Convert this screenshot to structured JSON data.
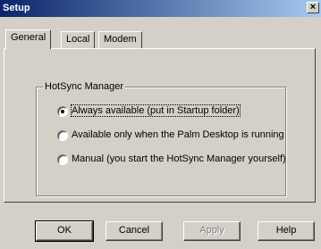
{
  "window": {
    "title": "Setup",
    "close_glyph": "×"
  },
  "tabs": [
    {
      "label": "General",
      "selected": true
    },
    {
      "label": "Local",
      "selected": false
    },
    {
      "label": "Modem",
      "selected": false
    }
  ],
  "group": {
    "label": "HotSync Manager",
    "options": [
      {
        "label": "Always available (put in Startup folder)",
        "checked": true
      },
      {
        "label": "Available only when the Palm Desktop is running",
        "checked": false
      },
      {
        "label": "Manual (you start the HotSync Manager yourself)",
        "checked": false
      }
    ]
  },
  "buttons": {
    "ok": "OK",
    "cancel": "Cancel",
    "apply": "Apply",
    "help": "Help"
  },
  "colors": {
    "title_bar": "#0a246a",
    "face": "#d4d0c8"
  }
}
